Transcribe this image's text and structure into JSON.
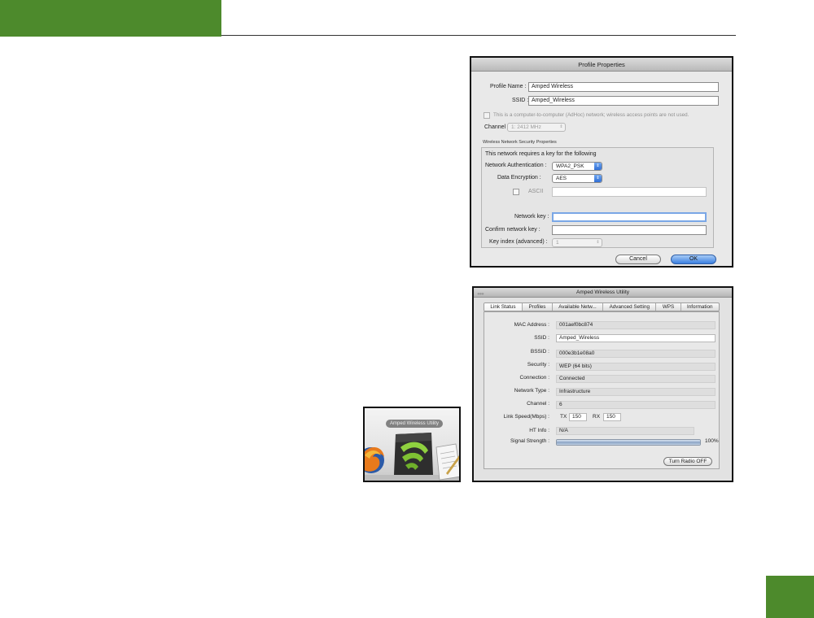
{
  "profile_properties": {
    "title": "Profile Properties",
    "profile_name_label": "Profile Name :",
    "profile_name_value": "Amped Wireless",
    "ssid_label": "SSID :",
    "ssid_value": "Amped_Wireless",
    "adhoc_text": "This is a computer-to-computer (AdHoc) network; wireless access points are not used.",
    "channel_label": "Channel :",
    "channel_value": "1: 2412 MHz",
    "security_group_label": "Wireless Network Security Properties",
    "requires_key_text": "This network requires a key for the following",
    "network_auth_label": "Network Authentication :",
    "network_auth_value": "WPA2_PSK",
    "data_encryption_label": "Data Encryption :",
    "data_encryption_value": "AES",
    "ascii_label": "ASCII",
    "network_key_label": "Network key :",
    "confirm_key_label": "Confirm network key :",
    "key_index_label": "Key index (advanced) :",
    "key_index_value": "1",
    "cancel_label": "Cancel",
    "ok_label": "OK"
  },
  "utility": {
    "title": "Amped Wireless Utility",
    "tabs": [
      {
        "label": "Link Status"
      },
      {
        "label": "Profiles"
      },
      {
        "label": "Available Netw..."
      },
      {
        "label": "Advanced Setting"
      },
      {
        "label": "WPS"
      },
      {
        "label": "Information"
      }
    ],
    "fields": {
      "mac_label": "MAC Address :",
      "mac_value": "001aef0bc874",
      "ssid_label": "SSID :",
      "ssid_value": "Amped_Wireless",
      "bssid_label": "BSSID :",
      "bssid_value": "000e3b1e08a0",
      "security_label": "Security :",
      "security_value": "WEP (64 bits)",
      "connection_label": "Connection :",
      "connection_value": "Connected",
      "network_type_label": "Network Type :",
      "network_type_value": "Infrastructure",
      "channel_label": "Channel :",
      "channel_value": "6",
      "link_speed_label": "Link Speed(Mbps) :",
      "tx_label": "TX",
      "tx_value": "150",
      "rx_label": "RX",
      "rx_value": "150",
      "ht_label": "HT Info :",
      "ht_value": "N/A",
      "signal_label": "Signal Strength :",
      "signal_percent_text": "100%",
      "signal_level": 1.0
    },
    "turn_radio_label": "Turn Radio OFF"
  },
  "dock": {
    "tooltip": "Amped Wireless Utility",
    "icons": [
      "firefox-icon",
      "amped-wireless-utility-icon",
      "textedit-icon"
    ]
  },
  "colors": {
    "brand_green": "#4d8a2c",
    "ok_button": "#3a7fe0"
  }
}
